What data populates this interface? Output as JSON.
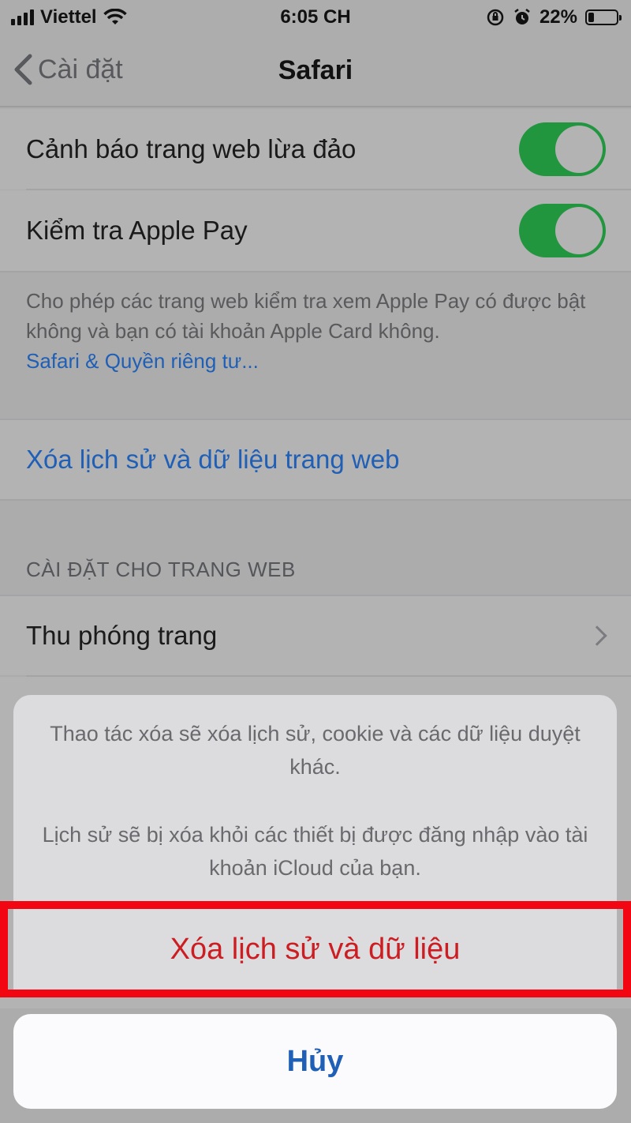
{
  "status_bar": {
    "carrier": "Viettel",
    "time": "6:05 CH",
    "battery": "22%",
    "battery_level": 0.22
  },
  "nav": {
    "back_label": "Cài đặt",
    "title": "Safari"
  },
  "settings": {
    "fraud_warning": {
      "label": "Cảnh báo trang web lừa đảo",
      "on": true
    },
    "apple_pay": {
      "label": "Kiểm tra Apple Pay",
      "on": true
    },
    "footer_text": "Cho phép các trang web kiểm tra xem Apple Pay có được bật không và bạn có tài khoản Apple Card không.",
    "footer_link": "Safari & Quyền riêng tư...",
    "clear_history": "Xóa lịch sử và dữ liệu trang web",
    "section_header": "CÀI ĐẶT CHO TRANG WEB",
    "page_zoom": "Thu phóng trang"
  },
  "sheet": {
    "message_1": "Thao tác xóa sẽ xóa lịch sử, cookie và các dữ liệu duyệt khác.",
    "message_2": "Lịch sử sẽ bị xóa khỏi các thiết bị được đăng nhập vào tài khoản iCloud của bạn.",
    "destructive_label": "Xóa lịch sử và dữ liệu",
    "cancel_label": "Hủy"
  },
  "colors": {
    "toggle_on": "#21963f",
    "link_blue": "#1f5fb6",
    "destructive_red": "#cb1d22",
    "highlight_red": "#f20611"
  }
}
